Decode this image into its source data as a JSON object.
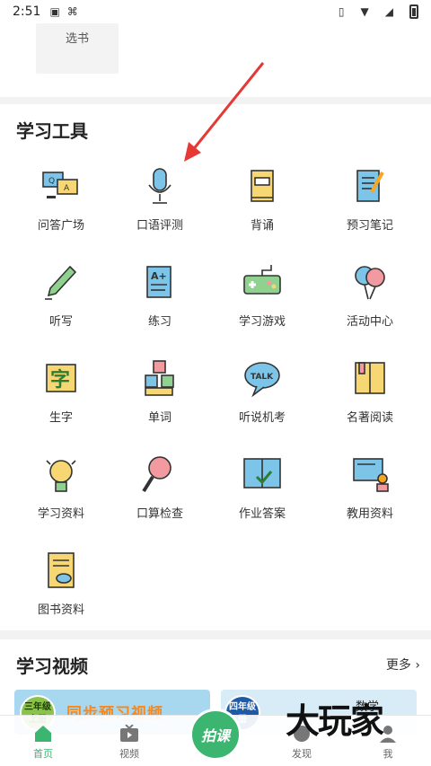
{
  "status_bar": {
    "time": "2:51"
  },
  "top": {
    "book_select_label": "选书"
  },
  "tools": {
    "title": "学习工具",
    "items": [
      {
        "label": "问答广场",
        "icon": "qa-chat-icon"
      },
      {
        "label": "口语评测",
        "icon": "microphone-icon"
      },
      {
        "label": "背诵",
        "icon": "book-icon"
      },
      {
        "label": "预习笔记",
        "icon": "notebook-pen-icon"
      },
      {
        "label": "听写",
        "icon": "pen-icon"
      },
      {
        "label": "练习",
        "icon": "exercise-sheet-icon"
      },
      {
        "label": "学习游戏",
        "icon": "gamepad-icon"
      },
      {
        "label": "活动中心",
        "icon": "balloons-icon"
      },
      {
        "label": "生字",
        "icon": "character-icon"
      },
      {
        "label": "单词",
        "icon": "letter-blocks-icon"
      },
      {
        "label": "听说机考",
        "icon": "talk-bubble-icon"
      },
      {
        "label": "名著阅读",
        "icon": "open-book-icon"
      },
      {
        "label": "学习资料",
        "icon": "lightbulb-icon"
      },
      {
        "label": "口算检查",
        "icon": "magnifier-icon"
      },
      {
        "label": "作业答案",
        "icon": "answer-book-icon"
      },
      {
        "label": "教用资料",
        "icon": "teacher-board-icon"
      },
      {
        "label": "图书资料",
        "icon": "document-cloud-icon"
      }
    ]
  },
  "video": {
    "title": "学习视频",
    "more_label": "更多",
    "banner1": {
      "badge": "三年级上册",
      "badge_line1": "三年级",
      "badge_line2": "上册",
      "text": "同步预习视频"
    },
    "banner2": {
      "badge_line1": "四年级",
      "badge_line2": "册",
      "text": "数学"
    }
  },
  "bottom_nav": {
    "home": "首页",
    "video": "视频",
    "center": "拍课",
    "discover": "发现",
    "me": "我"
  },
  "watermark": "大玩家",
  "colors": {
    "accent": "#3bb56f",
    "annotation_arrow": "#e53935"
  }
}
